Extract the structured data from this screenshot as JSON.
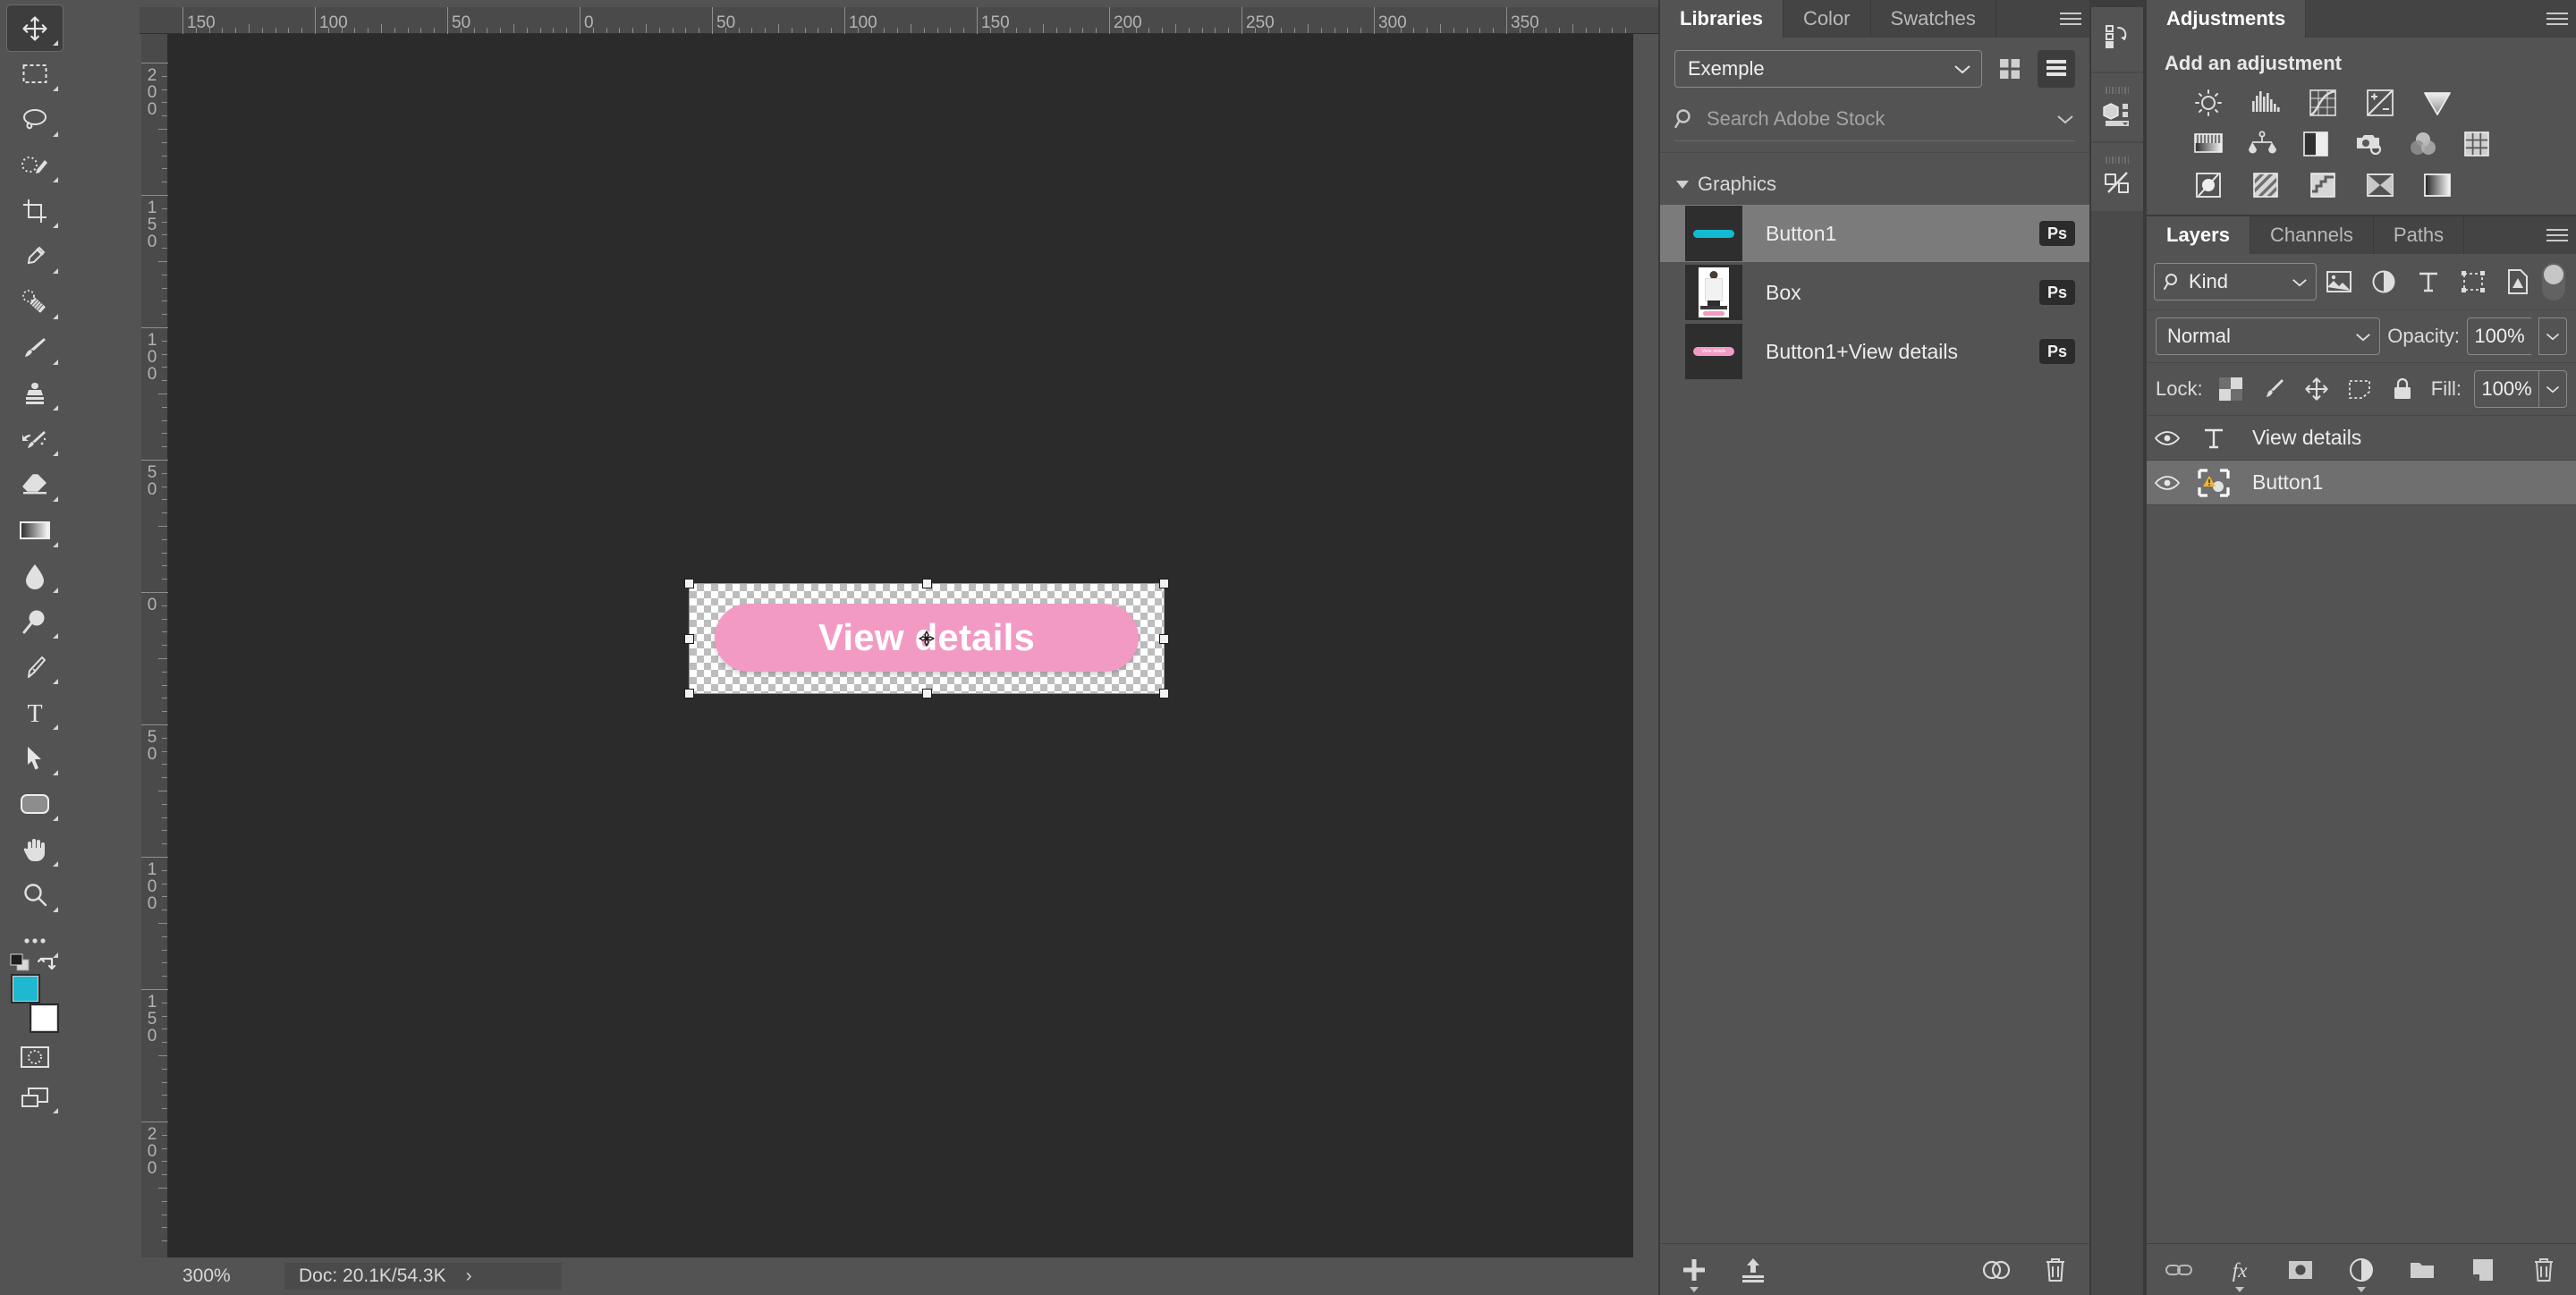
{
  "toolbar": {
    "tools": [
      {
        "name": "move-tool",
        "label": "Move Tool",
        "active": true
      },
      {
        "name": "rectangular-marquee-tool",
        "label": "Rectangular Marquee Tool",
        "active": false
      },
      {
        "name": "lasso-tool",
        "label": "Lasso Tool",
        "active": false
      },
      {
        "name": "object-selection-tool",
        "label": "Object Selection Tool",
        "active": false
      },
      {
        "name": "crop-tool",
        "label": "Crop Tool",
        "active": false
      },
      {
        "name": "eyedropper-tool",
        "label": "Eyedropper Tool",
        "active": false
      },
      {
        "name": "spot-healing-brush-tool",
        "label": "Spot Healing Brush Tool",
        "active": false
      },
      {
        "name": "brush-tool",
        "label": "Brush Tool",
        "active": false
      },
      {
        "name": "clone-stamp-tool",
        "label": "Clone Stamp Tool",
        "active": false
      },
      {
        "name": "history-brush-tool",
        "label": "History Brush Tool",
        "active": false
      },
      {
        "name": "eraser-tool",
        "label": "Eraser Tool",
        "active": false
      },
      {
        "name": "gradient-tool",
        "label": "Gradient Tool",
        "active": false
      },
      {
        "name": "blur-tool",
        "label": "Blur Tool",
        "active": false
      },
      {
        "name": "dodge-tool",
        "label": "Dodge Tool",
        "active": false
      },
      {
        "name": "pen-tool",
        "label": "Pen Tool",
        "active": false
      },
      {
        "name": "horizontal-type-tool",
        "label": "Horizontal Type Tool",
        "active": false
      },
      {
        "name": "path-selection-tool",
        "label": "Path Selection Tool",
        "active": false
      },
      {
        "name": "rectangle-tool",
        "label": "Rectangle Tool",
        "active": false
      },
      {
        "name": "hand-tool",
        "label": "Hand Tool",
        "active": false
      },
      {
        "name": "zoom-tool",
        "label": "Zoom Tool",
        "active": false
      },
      {
        "name": "edit-toolbar-tool",
        "label": "Edit Toolbar",
        "active": false
      }
    ],
    "foreground_color": "#1FB8D1",
    "background_color": "#FFFFFF",
    "quick_mask_label": "Edit in Quick Mask Mode",
    "screen_mode_label": "Change Screen Mode"
  },
  "rulers": {
    "horizontal_ticks": [
      "150",
      "100",
      "50",
      "0",
      "50",
      "100",
      "150",
      "200",
      "250",
      "300",
      "350"
    ],
    "vertical_ticks": [
      "200",
      "150",
      "100",
      "50",
      "0",
      "50",
      "100",
      "150",
      "200"
    ],
    "unit": "px"
  },
  "canvas": {
    "button": {
      "label": "View details",
      "fill_color": "#F29AC4",
      "text_color": "#FFFFFF"
    },
    "selection": {
      "handles": 8,
      "pivot_label": "transform-reference-point"
    }
  },
  "statusbar": {
    "zoom_level": "300%",
    "doc_info": "Doc: 20.1K/54.3K",
    "expand_arrow": "›"
  },
  "libraries": {
    "tabs": [
      {
        "label": "Libraries",
        "active": true
      },
      {
        "label": "Color",
        "active": false
      },
      {
        "label": "Swatches",
        "active": false
      }
    ],
    "selected_library": "Exemple",
    "view_grid_label": "Grid view",
    "view_list_label": "List view",
    "search_placeholder": "Search Adobe Stock",
    "group_title": "Graphics",
    "assets": [
      {
        "name": "Button1",
        "badge": "Ps",
        "selected": true,
        "thumb": "cyan-pill"
      },
      {
        "name": "Box",
        "badge": "Ps",
        "selected": false,
        "thumb": "product-photo"
      },
      {
        "name": "Button1+View details",
        "badge": "Ps",
        "selected": false,
        "thumb": "pink-pill"
      }
    ],
    "footer": {
      "add_label": "Add content",
      "upload_label": "Upload to library",
      "cc_label": "Open Creative Cloud",
      "delete_label": "Delete"
    }
  },
  "rail": {
    "items": [
      {
        "name": "history-panel-icon",
        "label": "History"
      },
      {
        "name": "3d-panel-icon",
        "label": "3D"
      },
      {
        "name": "actions-panel-icon",
        "label": "Actions"
      }
    ]
  },
  "adjustments": {
    "tab_label": "Adjustments",
    "heading": "Add an adjustment",
    "row1": [
      {
        "name": "brightness-contrast-icon",
        "label": "Brightness/Contrast"
      },
      {
        "name": "levels-icon",
        "label": "Levels"
      },
      {
        "name": "curves-icon",
        "label": "Curves"
      },
      {
        "name": "exposure-icon",
        "label": "Exposure"
      },
      {
        "name": "vibrance-icon",
        "label": "Vibrance"
      }
    ],
    "row2": [
      {
        "name": "hue-saturation-icon",
        "label": "Hue/Saturation"
      },
      {
        "name": "color-balance-icon",
        "label": "Color Balance"
      },
      {
        "name": "black-white-icon",
        "label": "Black & White"
      },
      {
        "name": "photo-filter-icon",
        "label": "Photo Filter"
      },
      {
        "name": "channel-mixer-icon",
        "label": "Channel Mixer"
      },
      {
        "name": "color-lookup-icon",
        "label": "Color Lookup"
      }
    ],
    "row3": [
      {
        "name": "invert-icon",
        "label": "Invert"
      },
      {
        "name": "posterize-icon",
        "label": "Posterize"
      },
      {
        "name": "threshold-icon",
        "label": "Threshold"
      },
      {
        "name": "selective-color-icon",
        "label": "Selective Color"
      },
      {
        "name": "gradient-map-icon",
        "label": "Gradient Map"
      }
    ]
  },
  "layers": {
    "tabs": [
      {
        "label": "Layers",
        "active": true
      },
      {
        "label": "Channels",
        "active": false
      },
      {
        "label": "Paths",
        "active": false
      }
    ],
    "filter": {
      "kind_label": "Kind",
      "icons": [
        {
          "name": "filter-pixel-layers-icon",
          "label": "Pixel layers"
        },
        {
          "name": "filter-adjustment-layers-icon",
          "label": "Adjustment layers"
        },
        {
          "name": "filter-type-layers-icon",
          "label": "Type layers"
        },
        {
          "name": "filter-shape-layers-icon",
          "label": "Shape layers"
        },
        {
          "name": "filter-smart-objects-icon",
          "label": "Smart objects"
        }
      ],
      "toggle_label": "Turn layer filtering on/off"
    },
    "blend_mode": "Normal",
    "opacity_label": "Opacity:",
    "opacity_value": "100%",
    "lock_label": "Lock:",
    "lock_icons": [
      {
        "name": "lock-transparent-pixels-icon",
        "label": "Lock transparent pixels"
      },
      {
        "name": "lock-image-pixels-icon",
        "label": "Lock image pixels"
      },
      {
        "name": "lock-position-icon",
        "label": "Lock position"
      },
      {
        "name": "lock-artboard-nesting-icon",
        "label": "Prevent auto-nesting"
      },
      {
        "name": "lock-all-icon",
        "label": "Lock all"
      }
    ],
    "fill_label": "Fill:",
    "fill_value": "100%",
    "rows": [
      {
        "name": "View details",
        "type": "type",
        "visible": true,
        "selected": false
      },
      {
        "name": "Button1",
        "type": "linked-smart-object",
        "visible": true,
        "selected": true
      }
    ],
    "footer": [
      {
        "name": "link-layers-icon",
        "label": "Link layers"
      },
      {
        "name": "layer-style-fx-icon",
        "label": "Add a layer style"
      },
      {
        "name": "add-layer-mask-icon",
        "label": "Add layer mask"
      },
      {
        "name": "new-adjustment-layer-icon",
        "label": "Create new fill or adjustment layer"
      },
      {
        "name": "new-group-icon",
        "label": "Create a new group"
      },
      {
        "name": "new-layer-icon",
        "label": "Create a new layer"
      },
      {
        "name": "delete-layer-icon",
        "label": "Delete layer"
      }
    ]
  }
}
